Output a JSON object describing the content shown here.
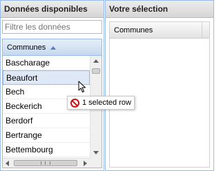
{
  "available": {
    "title": "Données disponibles",
    "filter": {
      "placeholder": "Filtre les données",
      "value": ""
    },
    "column_header": "Communes",
    "sort": "ascending",
    "rows": [
      "Bascharage",
      "Beaufort",
      "Bech",
      "Beckerich",
      "Berdorf",
      "Bertrange",
      "Bettembourg"
    ],
    "selected_row": "Beaufort"
  },
  "selection": {
    "title": "Votre sélection",
    "column_header": "Communes"
  },
  "drag_tooltip": {
    "icon": "no-entry-icon",
    "text": "1 selected row"
  },
  "colors": {
    "panel_border": "#99bbe8",
    "selected_row": "#dfe8f6",
    "no_entry": "#cc1111"
  }
}
